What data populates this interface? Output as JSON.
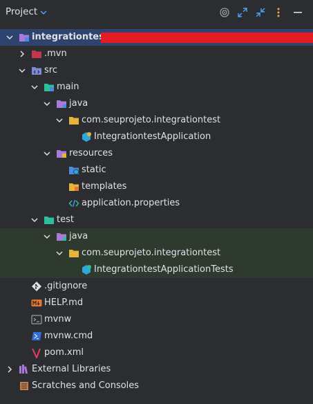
{
  "panel": {
    "title": "Project"
  },
  "rows": [
    {
      "label": "integrationtest",
      "redacted": true
    },
    {
      "label": ".mvn"
    },
    {
      "label": "src"
    },
    {
      "label": "main"
    },
    {
      "label": "java"
    },
    {
      "label": "com.seuprojeto.integrationtest"
    },
    {
      "label": "IntegrationtestApplication"
    },
    {
      "label": "resources"
    },
    {
      "label": "static"
    },
    {
      "label": "templates"
    },
    {
      "label": "application.properties"
    },
    {
      "label": "test"
    },
    {
      "label": "java"
    },
    {
      "label": "com.seuprojeto.integrationtest"
    },
    {
      "label": "IntegrationtestApplicationTests"
    },
    {
      "label": ".gitignore"
    },
    {
      "label": "HELP.md"
    },
    {
      "label": "mvnw"
    },
    {
      "label": "mvnw.cmd"
    },
    {
      "label": "pom.xml"
    },
    {
      "label": "External Libraries"
    },
    {
      "label": "Scratches and Consoles"
    }
  ],
  "colors": {
    "background": "#2b2d30",
    "selection": "#2e436e",
    "test_highlight": "#2f3a2f",
    "redaction": "#e51c23",
    "folder_yellow": "#e8b33a",
    "folder_blue": "#4a8de0",
    "module_purple": "#a97bd9",
    "test_teal": "#2bbf9b"
  }
}
